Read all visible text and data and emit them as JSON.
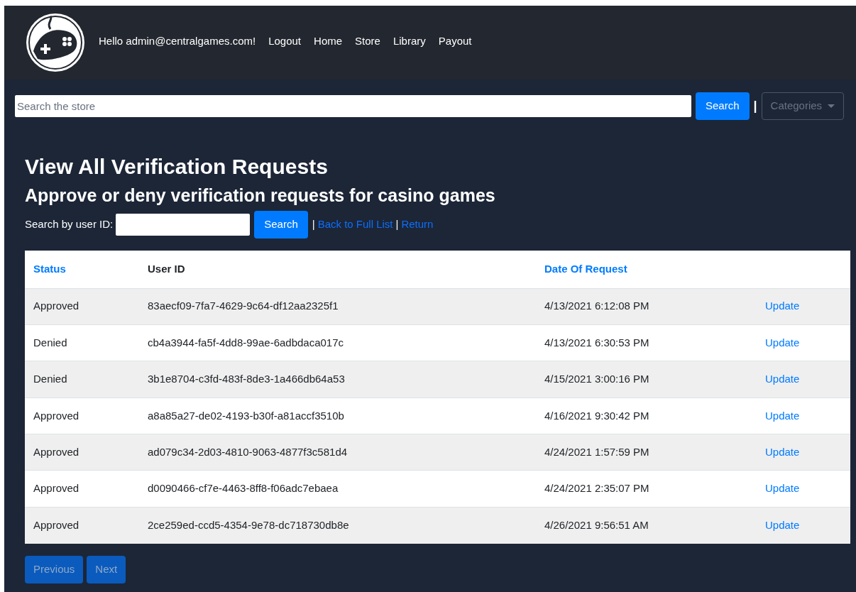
{
  "navbar": {
    "greeting": "Hello admin@centralgames.com!",
    "links": [
      "Logout",
      "Home",
      "Store",
      "Library",
      "Payout"
    ]
  },
  "store_search": {
    "placeholder": "Search the store",
    "button": "Search",
    "separator": "|",
    "categories": {
      "label": "Categories",
      "disabled": true
    }
  },
  "heading": "View All Verification Requests",
  "subheading": "Approve or deny verification requests for casino games",
  "user_search": {
    "label": "Search by user ID:",
    "button": "Search",
    "separator_1": "|",
    "back_link": "Back to Full List",
    "separator_2": "|",
    "return_link": "Return"
  },
  "table": {
    "columns": [
      {
        "label": "Status",
        "sortable": true
      },
      {
        "label": "User ID",
        "sortable": false
      },
      {
        "label": "Date Of Request",
        "sortable": true
      }
    ],
    "rows": [
      {
        "status": "Approved",
        "user_id": "83aecf09-7fa7-4629-9c64-df12aa2325f1",
        "date": "4/13/2021 6:12:08 PM",
        "action": "Update"
      },
      {
        "status": "Denied",
        "user_id": "cb4a3944-fa5f-4dd8-99ae-6adbdaca017c",
        "date": "4/13/2021 6:30:53 PM",
        "action": "Update"
      },
      {
        "status": "Denied",
        "user_id": "3b1e8704-c3fd-483f-8de3-1a466db64a53",
        "date": "4/15/2021 3:00:16 PM",
        "action": "Update"
      },
      {
        "status": "Approved",
        "user_id": "a8a85a27-de02-4193-b30f-a81accf3510b",
        "date": "4/16/2021 9:30:42 PM",
        "action": "Update"
      },
      {
        "status": "Approved",
        "user_id": "ad079c34-2d03-4810-9063-4877f3c581d4",
        "date": "4/24/2021 1:57:59 PM",
        "action": "Update"
      },
      {
        "status": "Approved",
        "user_id": "d0090466-cf7e-4463-8ff8-f06adc7ebaea",
        "date": "4/24/2021 2:35:07 PM",
        "action": "Update"
      },
      {
        "status": "Approved",
        "user_id": "2ce259ed-ccd5-4354-9e78-dc718730db8e",
        "date": "4/26/2021 9:56:51 AM",
        "action": "Update"
      }
    ]
  },
  "pager": [
    {
      "label": "Previous",
      "disabled": true
    },
    {
      "label": "Next",
      "disabled": true
    }
  ]
}
